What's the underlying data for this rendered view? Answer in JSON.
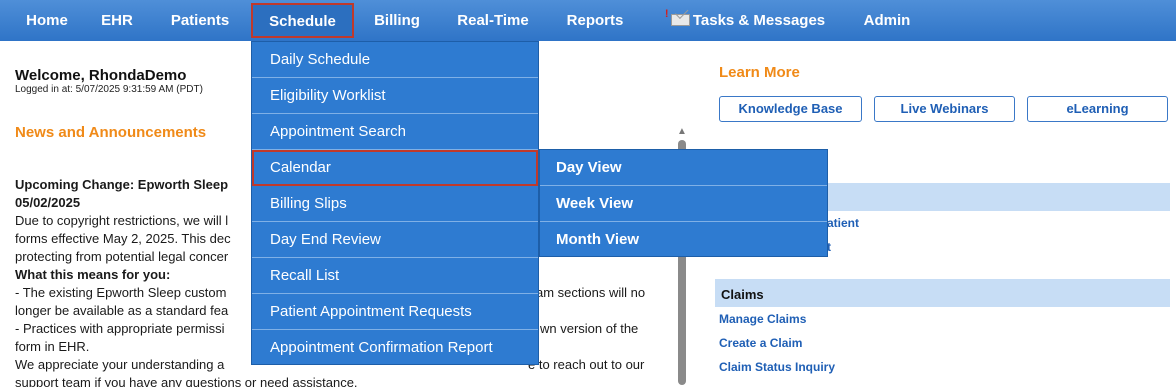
{
  "nav": {
    "items": [
      "Home",
      "EHR",
      "Patients",
      "Schedule",
      "Billing",
      "Real-Time",
      "Reports",
      "Tasks & Messages",
      "Admin"
    ],
    "active": "Schedule"
  },
  "welcome": {
    "title": "Welcome, RhondaDemo",
    "logged_in": "Logged in at: 5/07/2025 9:31:59 AM (PDT)"
  },
  "news": {
    "heading": "News and Announcements",
    "title_line1": "Upcoming Change: Epworth Sleep",
    "title_line2": "05/02/2025",
    "l1": "Due to copyright restrictions, we will l",
    "l2": "forms effective May 2, 2025. This dec",
    "l3": "protecting from potential legal concer",
    "subheading": "What this means for you:",
    "l4a": "- The existing Epworth Sleep custom",
    "l4b": "am sections will no",
    "l5": "longer be available as a standard fea",
    "l6a": "- Practices with appropriate permissi",
    "l6b": "wn version of the",
    "l7": "form in EHR.",
    "l8a": "We appreciate your understanding a",
    "l8b": "e to reach out to our",
    "l9": "support team if you have any questions or need assistance."
  },
  "learn_more": {
    "heading": "Learn More",
    "buttons": [
      "Knowledge Base",
      "Live Webinars",
      "eLearning"
    ]
  },
  "patient_links": [
    "atient",
    "t"
  ],
  "claims": {
    "title": "Claims",
    "links": [
      "Manage Claims",
      "Create a Claim",
      "Claim Status Inquiry"
    ]
  },
  "schedule_menu": {
    "items": [
      "Daily Schedule",
      "Eligibility Worklist",
      "Appointment Search",
      "Calendar",
      "Billing Slips",
      "Day End Review",
      "Recall List",
      "Patient Appointment Requests",
      "Appointment Confirmation Report"
    ],
    "selected": "Calendar"
  },
  "calendar_submenu": {
    "items": [
      "Day View",
      "Week View",
      "Month View"
    ]
  },
  "colors": {
    "nav_bg": "#2f74c7",
    "menu_bg": "#2e7bd1",
    "accent_orange": "#f08a18",
    "link_blue": "#1f5fb5",
    "section_bar": "#c7ddf5",
    "selected_border": "#c0392b"
  }
}
